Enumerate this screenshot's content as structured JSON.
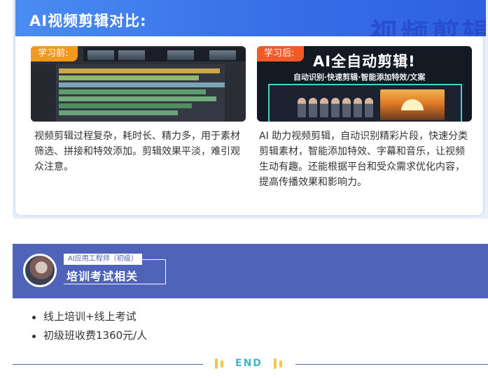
{
  "compare": {
    "title": "AI视频剪辑对比:",
    "watermark": "视频剪辑",
    "before": {
      "tag": "学习前:",
      "text": "视频剪辑过程复杂，耗时长、精力多，用于素材筛选、拼接和特效添加。剪辑效果平淡，难引观众注意。"
    },
    "after": {
      "tag": "学习后:",
      "banner": "AI全自动剪辑!",
      "sub": "自动识别·快速剪辑·智能添加特效/文案",
      "text": "AI 助力视频剪辑，自动识别精彩片段，快速分类剪辑素材，智能添加特效、字幕和音乐，让视频生动有趣。还能根据平台和受众需求优化内容，提高传播效果和影响力。"
    }
  },
  "training": {
    "small_label": "AI应用工程师（初级）",
    "title": "培训考试相关",
    "bullets": [
      "线上培训+线上考试",
      "初级班收费1360元/人"
    ]
  },
  "end_label": "END",
  "colors": {
    "header_blue": "#3a73ea",
    "band_blue": "#4f63b8",
    "tag_orange": "#f39a1e",
    "end_teal": "#45b4c8",
    "end_yellow": "#f2c84b"
  }
}
